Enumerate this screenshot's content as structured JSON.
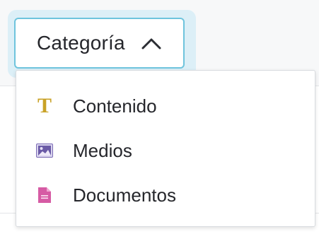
{
  "filter": {
    "label": "Categoría",
    "state_icon": "chevron-up-icon"
  },
  "menu": {
    "items": [
      {
        "label": "Contenido",
        "icon": "text-icon",
        "icon_glyph": "T",
        "color": "#c9a227"
      },
      {
        "label": "Medios",
        "icon": "image-icon",
        "color": "#7b6bb5"
      },
      {
        "label": "Documentos",
        "icon": "document-icon",
        "color": "#d65ba4"
      }
    ]
  },
  "colors": {
    "focus_border": "#6ec4dd",
    "focus_halo": "#dceff7",
    "text": "#25262b"
  }
}
